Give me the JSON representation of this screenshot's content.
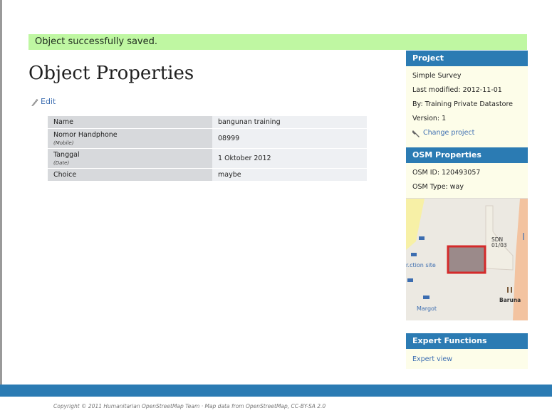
{
  "flash": {
    "message": "Object successfully saved."
  },
  "page": {
    "title": "Object Properties",
    "edit_label": "Edit"
  },
  "properties": [
    {
      "key": "Name",
      "sub": "",
      "value": "bangunan training"
    },
    {
      "key": "Nomor Handphone",
      "sub": "(Mobile)",
      "value": "08999"
    },
    {
      "key": "Tanggal",
      "sub": "(Date)",
      "value": "1 Oktober 2012"
    },
    {
      "key": "Choice",
      "sub": "",
      "value": "maybe"
    }
  ],
  "project": {
    "header": "Project",
    "name": "Simple Survey",
    "last_modified": "Last modified: 2012-11-01",
    "by": "By: Training Private Datastore",
    "version": "Version: 1",
    "change_label": "Change project"
  },
  "osm": {
    "header": "OSM Properties",
    "id_line": "OSM ID: 120493057",
    "type_line": "OSM Type: way"
  },
  "map": {
    "label_site": "r.ction site",
    "label_margot": "Margot",
    "label_sdn": "SDN\n01/03",
    "label_baruna": "Baruna"
  },
  "expert": {
    "header": "Expert Functions",
    "view_label": "Expert view"
  },
  "footer": {
    "copyright": "Copyright © 2011 Humanitarian OpenStreetMap Team · Map data from OpenStreetMap, CC-BY-SA 2.0"
  },
  "colors": {
    "accent": "#2b7bb3",
    "flash_bg": "#bff7a2",
    "sidebar_bg": "#fdfde9",
    "feature_fill": "#9b8a8a",
    "feature_stroke": "#d42a2a"
  }
}
